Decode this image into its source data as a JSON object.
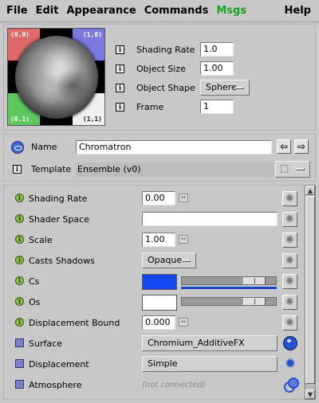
{
  "menu": {
    "file": "File",
    "edit": "Edit",
    "appearance": "Appearance",
    "commands": "Commands",
    "msgs": "Msgs",
    "help": "Help"
  },
  "preview": {
    "corner_tl": "(0,0)",
    "corner_tr": "(1,0)",
    "corner_bl": "(0,1)",
    "corner_br": "(1,1)"
  },
  "header_props": [
    {
      "icon": "i",
      "label": "Shading Rate",
      "value": "1.0"
    },
    {
      "icon": "i",
      "label": "Object Size",
      "value": "1.00"
    },
    {
      "icon": "i",
      "label": "Object Shape",
      "value": "Sphere"
    },
    {
      "icon": "i",
      "label": "Frame",
      "value": "1"
    }
  ],
  "name_panel": {
    "name_label": "Name",
    "name_value": "Chromatron",
    "back_arrow": "⇦",
    "forward_arrow": "⇨",
    "template_label": "Template",
    "template_value": "Ensemble (v0)",
    "template_icon": "i"
  },
  "params": [
    {
      "icon": "i",
      "label": "Shading Rate",
      "value": "0.00",
      "tiny": "↔"
    },
    {
      "icon": "i",
      "label": "Shader Space",
      "value": ""
    },
    {
      "icon": "i",
      "label": "Scale",
      "value": "1.00",
      "tiny": "↔"
    },
    {
      "icon": "i",
      "label": "Casts Shadows",
      "value": "Opaque"
    },
    {
      "icon": "i",
      "label": "Cs",
      "color": "#1447f0",
      "slider_level": 0.85
    },
    {
      "icon": "i",
      "label": "Os",
      "color": "#ffffff",
      "slider_level": 0.85
    },
    {
      "icon": "i",
      "label": "Displacement Bound",
      "value": "0.000",
      "tiny": "↔"
    },
    {
      "label": "Surface",
      "value": "Chromium_AdditiveFX"
    },
    {
      "label": "Displacement",
      "value": "Simple"
    },
    {
      "label": "Atmosphere",
      "value": "(not connected)"
    }
  ],
  "scroll": {
    "up": "▲",
    "down": "▼"
  },
  "colors": {
    "accent": "#2852d0",
    "msgs_green": "#1aa01a",
    "param_dot": "#8fbf3c"
  }
}
